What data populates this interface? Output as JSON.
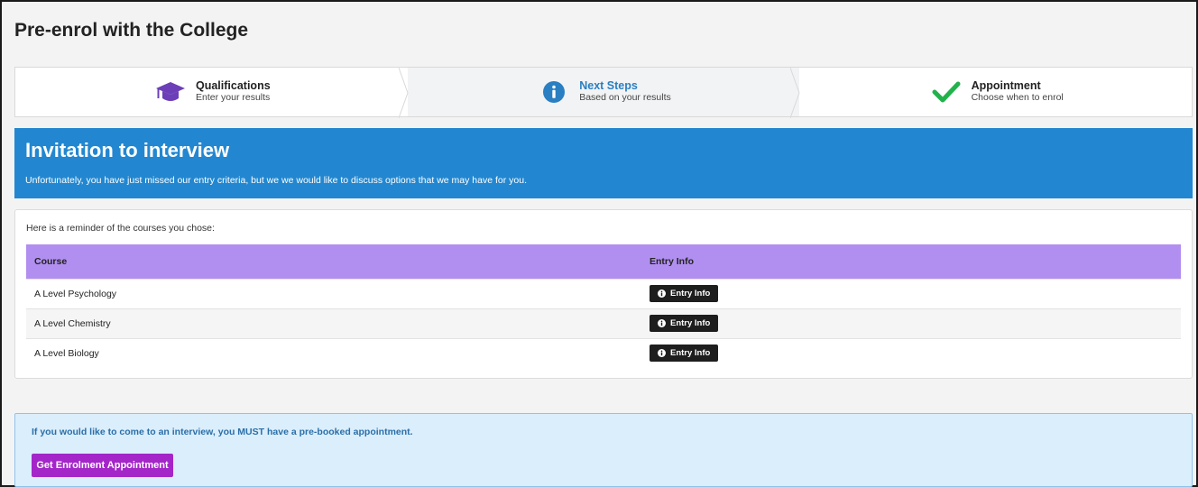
{
  "page": {
    "title": "Pre-enrol with the College"
  },
  "steps": [
    {
      "title": "Qualifications",
      "subtitle": "Enter your results",
      "icon": "graduation-cap-icon"
    },
    {
      "title": "Next Steps",
      "subtitle": "Based on your results",
      "icon": "info-circle-icon"
    },
    {
      "title": "Appointment",
      "subtitle": "Choose when to enrol",
      "icon": "check-icon"
    }
  ],
  "banner": {
    "title": "Invitation to interview",
    "text": "Unfortunately, you have just missed our entry criteria, but we we would like to discuss options that we may have for you."
  },
  "courses": {
    "intro": "Here is a reminder of the courses you chose:",
    "headers": {
      "course": "Course",
      "entry": "Entry Info"
    },
    "rows": [
      {
        "course": "A Level Psychology",
        "button": "Entry Info"
      },
      {
        "course": "A Level Chemistry",
        "button": "Entry Info"
      },
      {
        "course": "A Level Biology",
        "button": "Entry Info"
      }
    ]
  },
  "appointment": {
    "text": "If you would like to come to an interview, you MUST have a pre-booked appointment.",
    "button": "Get Enrolment Appointment"
  },
  "colors": {
    "banner": "#2287d0",
    "table_header": "#b18ff0",
    "appointment_button": "#a426c9",
    "step_check": "#22b24c",
    "step_cap": "#6c3fb8"
  }
}
